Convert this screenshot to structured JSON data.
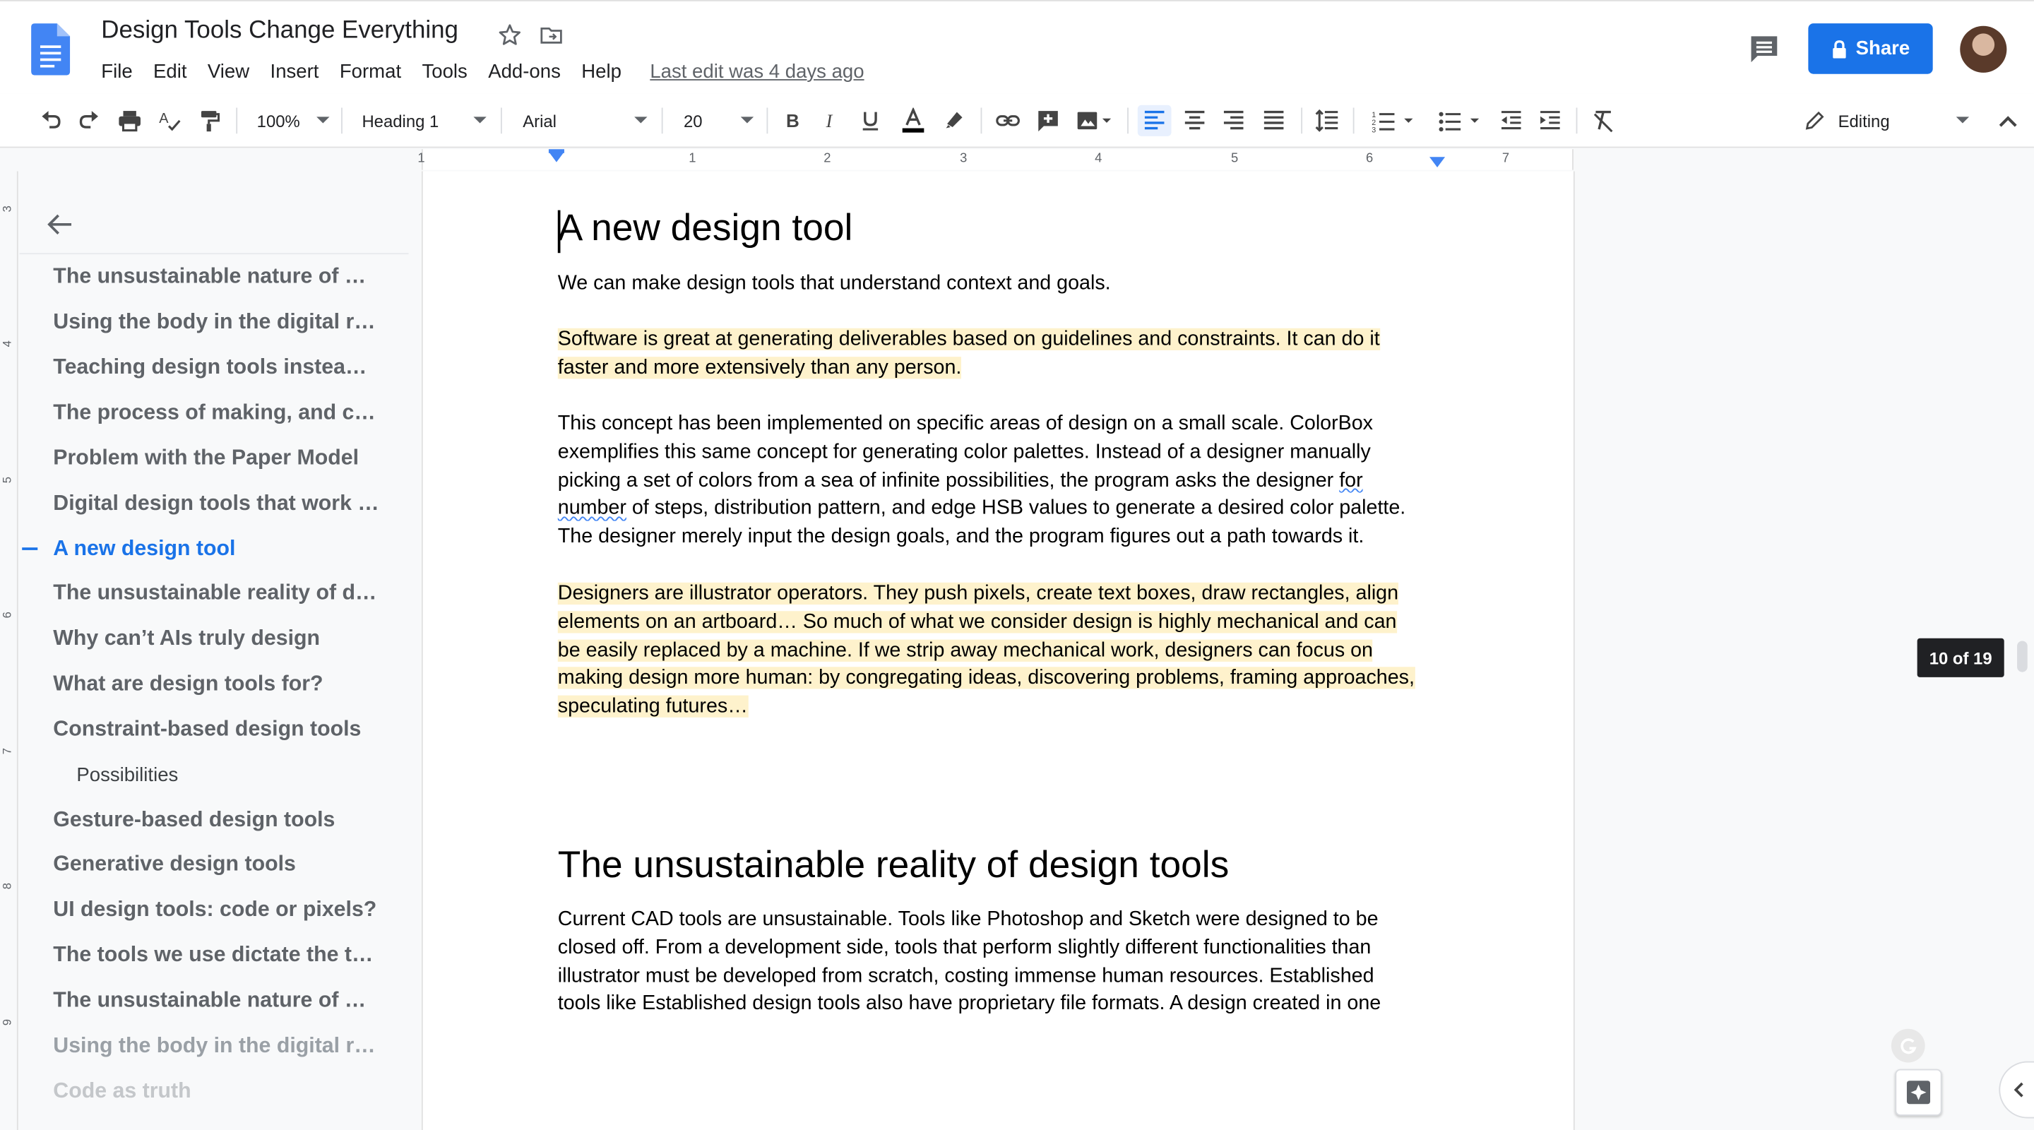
{
  "header": {
    "doc_title": "Design Tools Change Everything",
    "menu": [
      "File",
      "Edit",
      "View",
      "Insert",
      "Format",
      "Tools",
      "Add-ons",
      "Help"
    ],
    "last_edit": "Last edit was 4 days ago",
    "share_label": "Share"
  },
  "toolbar": {
    "zoom": "100%",
    "style": "Heading 1",
    "font": "Arial",
    "font_size": "20",
    "mode": "Editing"
  },
  "ruler": {
    "numbers": [
      "1",
      "1",
      "2",
      "3",
      "4",
      "5",
      "6",
      "7"
    ]
  },
  "vruler": {
    "numbers": [
      "3",
      "4",
      "5",
      "6",
      "7",
      "8",
      "9"
    ]
  },
  "outline": {
    "items": [
      "The unsustainable nature of …",
      "Using the body in the digital r…",
      "Teaching design tools instea…",
      "The process of making, and c…",
      "Problem with the Paper Model",
      "Digital design tools that work …",
      "A new design tool",
      "The unsustainable reality of d…",
      "Why can’t AIs truly design",
      "What are design tools for?",
      "Constraint-based design tools",
      "Possibilities",
      "Gesture-based design tools",
      "Generative design tools",
      "UI design tools: code or pixels?",
      "The tools we use dictate the t…",
      "The unsustainable nature of …",
      "Using the body in the digital r…",
      "Code as truth"
    ]
  },
  "document": {
    "heading1": "A new design tool",
    "p1": "We can make design tools that understand context and goals.",
    "p2_line1": "Software is great at generating deliverables based on guidelines and constraints. It can do it",
    "p2_line2": "faster and more extensively than any person.",
    "p3_line1": "This concept has been implemented on specific areas of design on a small scale. ColorBox",
    "p3_line2": "exemplifies this same concept for generating color palettes. Instead of a designer manually",
    "p3_line3a": "picking a set of colors from a sea of infinite possibilities, the program asks the designer ",
    "p3_line3b": "for",
    "p3_line4a": "number",
    "p3_line4b": " of steps, distribution pattern, and edge HSB values to generate a desired color palette.",
    "p3_line5": "The designer merely input the design goals, and the program figures out a path towards it.",
    "p4_line1": "Designers are illustrator operators. They push pixels, create text boxes, draw rectangles, align",
    "p4_line2": "elements on an artboard…  So much of what we consider design is highly mechanical and can",
    "p4_line3": "be easily replaced by a machine. If we strip away mechanical work, designers can focus on",
    "p4_line4": "making design more human: by congregating ideas, discovering problems, framing approaches,",
    "p4_line5": "speculating futures…",
    "heading2": "The unsustainable reality of design tools",
    "p5_line1": "Current CAD tools are unsustainable. Tools like Photoshop and Sketch were designed to be",
    "p5_line2": "closed off. From a development side, tools that perform slightly different functionalities than",
    "p5_line3": "illustrator must be developed from scratch, costing immense human resources. Established",
    "p5_line4": "tools like Established design tools also have proprietary file formats. A design created in one"
  },
  "page_counter": "10 of 19",
  "colors": {
    "accent": "#1a73e8",
    "highlight": "#fef2cc"
  }
}
